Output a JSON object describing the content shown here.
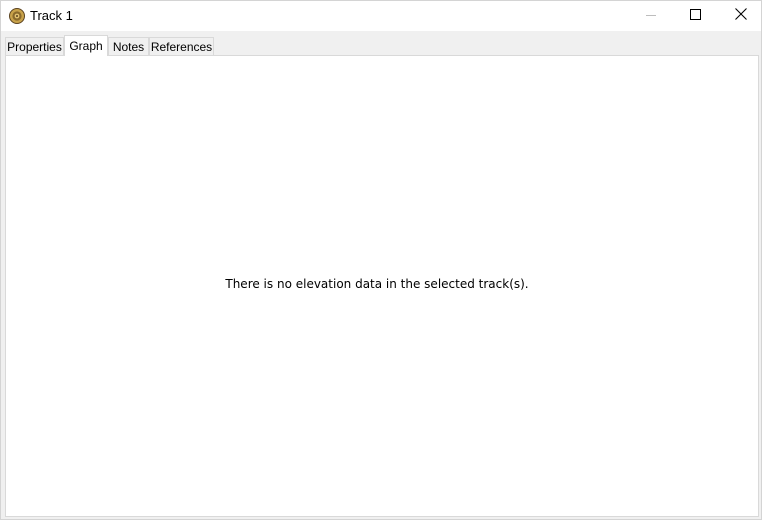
{
  "window": {
    "title": "Track 1",
    "app_icon": "track-app-icon",
    "controls": {
      "minimize_icon": "minimize-icon",
      "maximize_icon": "maximize-icon",
      "close_icon": "close-icon"
    }
  },
  "tabs": [
    {
      "label": "Properties",
      "active": false
    },
    {
      "label": "Graph",
      "active": true
    },
    {
      "label": "Notes",
      "active": false
    },
    {
      "label": "References",
      "active": false
    }
  ],
  "graph_panel": {
    "message": "There is no elevation data in the selected track(s)."
  },
  "colors": {
    "icon_gold": "#c8a24a",
    "icon_dark": "#5b4320"
  }
}
